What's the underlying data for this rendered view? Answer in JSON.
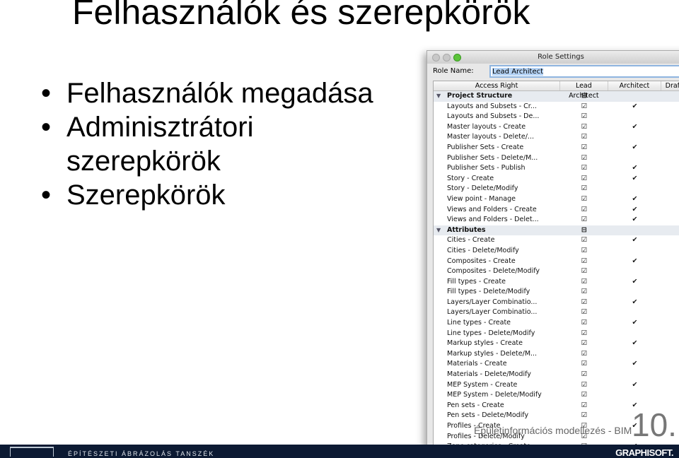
{
  "slide": {
    "title": "Felhasználók és szerepkörök",
    "bullets": [
      "Felhasználók megadása",
      "Adminisztrátori szerepkörök",
      "Szerepkörök"
    ],
    "subtitle": "Épületinformációs modellezés - BIM",
    "number": "10.",
    "department": "ÉPÍTÉSZETI ÁBRÁZOLÁS TANSZÉK",
    "brand": "GRAPHISOFT."
  },
  "window": {
    "title": "Role Settings",
    "role_name_label": "Role Name:",
    "role_name_value": "Lead Architect",
    "columns": [
      "Access Right",
      "Lead Architect",
      "Architect",
      "Draftsma"
    ],
    "rows": [
      {
        "label": "Project Structure",
        "group": true,
        "lead": "mixed",
        "arch": false
      },
      {
        "label": "Layouts and Subsets - Cr...",
        "lead": true,
        "arch": true
      },
      {
        "label": "Layouts and Subsets - De...",
        "lead": true,
        "arch": false
      },
      {
        "label": "Master layouts - Create",
        "lead": true,
        "arch": true
      },
      {
        "label": "Master layouts - Delete/...",
        "lead": true,
        "arch": false
      },
      {
        "label": "Publisher Sets - Create",
        "lead": true,
        "arch": true
      },
      {
        "label": "Publisher Sets - Delete/M...",
        "lead": true,
        "arch": false
      },
      {
        "label": "Publisher Sets - Publish",
        "lead": true,
        "arch": true
      },
      {
        "label": "Story - Create",
        "lead": true,
        "arch": true
      },
      {
        "label": "Story - Delete/Modify",
        "lead": true,
        "arch": false
      },
      {
        "label": "View point - Manage",
        "lead": true,
        "arch": true
      },
      {
        "label": "Views and Folders - Create",
        "lead": true,
        "arch": true
      },
      {
        "label": "Views and Folders - Delet...",
        "lead": true,
        "arch": true
      },
      {
        "label": "Attributes",
        "group": true,
        "lead": "mixed",
        "arch": false
      },
      {
        "label": "Cities - Create",
        "lead": true,
        "arch": true
      },
      {
        "label": "Cities - Delete/Modify",
        "lead": true,
        "arch": false
      },
      {
        "label": "Composites - Create",
        "lead": true,
        "arch": true
      },
      {
        "label": "Composites - Delete/Modify",
        "lead": true,
        "arch": false
      },
      {
        "label": "Fill types - Create",
        "lead": true,
        "arch": true
      },
      {
        "label": "Fill types - Delete/Modify",
        "lead": true,
        "arch": false
      },
      {
        "label": "Layers/Layer Combinatio...",
        "lead": true,
        "arch": true
      },
      {
        "label": "Layers/Layer Combinatio...",
        "lead": true,
        "arch": false
      },
      {
        "label": "Line types - Create",
        "lead": true,
        "arch": true
      },
      {
        "label": "Line types - Delete/Modify",
        "lead": true,
        "arch": false
      },
      {
        "label": "Markup styles - Create",
        "lead": true,
        "arch": true
      },
      {
        "label": "Markup styles - Delete/M...",
        "lead": true,
        "arch": false
      },
      {
        "label": "Materials - Create",
        "lead": true,
        "arch": true
      },
      {
        "label": "Materials - Delete/Modify",
        "lead": true,
        "arch": false
      },
      {
        "label": "MEP System - Create",
        "lead": true,
        "arch": true
      },
      {
        "label": "MEP System - Delete/Modify",
        "lead": true,
        "arch": false
      },
      {
        "label": "Pen sets - Create",
        "lead": true,
        "arch": true
      },
      {
        "label": "Pen sets - Delete/Modify",
        "lead": true,
        "arch": false
      },
      {
        "label": "Profiles - Create",
        "lead": true,
        "arch": true
      },
      {
        "label": "Profiles - Delete/Modify",
        "lead": true,
        "arch": false
      },
      {
        "label": "Zone categories - Create",
        "lead": true,
        "arch": true
      }
    ]
  }
}
